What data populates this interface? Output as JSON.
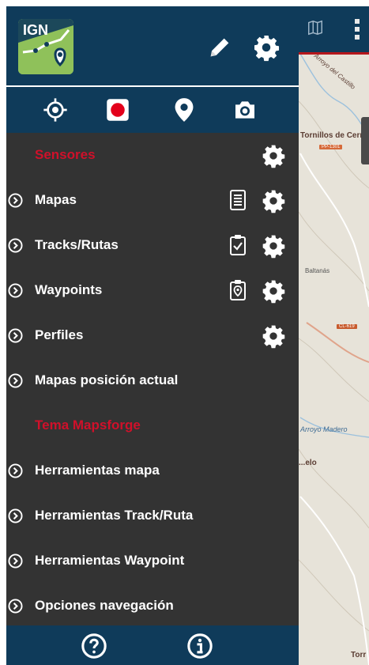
{
  "map": {
    "labels": [
      {
        "text": "Arroyo del Castillo"
      },
      {
        "text": "Tornillos de Cerrato"
      },
      {
        "text": "Baltanás"
      },
      {
        "text": "Arroyo Madero"
      },
      {
        "text": "...elo"
      },
      {
        "text": "Torr"
      }
    ],
    "roads": [
      {
        "text": "PP-1301"
      },
      {
        "text": "CL-619"
      }
    ]
  },
  "header": {
    "logo_text": "IGN",
    "icons": [
      "pencil-icon",
      "settings-icon"
    ]
  },
  "toolbar": {
    "items": [
      "crosshair-icon",
      "record-icon",
      "location-pin-icon",
      "camera-icon"
    ]
  },
  "menu": {
    "items": [
      {
        "label": "Sensores",
        "type": "category",
        "gear": true
      },
      {
        "label": "Mapas",
        "type": "item",
        "extra": "document-list-icon",
        "gear": true
      },
      {
        "label": "Tracks/Rutas",
        "type": "item",
        "extra": "clipboard-check-icon",
        "gear": true
      },
      {
        "label": "Waypoints",
        "type": "item",
        "extra": "clipboard-pin-icon",
        "gear": true
      },
      {
        "label": "Perfiles",
        "type": "item",
        "gear": true
      },
      {
        "label": "Mapas posición actual",
        "type": "item"
      },
      {
        "label": "Tema Mapsforge",
        "type": "category"
      },
      {
        "label": "Herramientas mapa",
        "type": "item"
      },
      {
        "label": "Herramientas Track/Ruta",
        "type": "item"
      },
      {
        "label": "Herramientas Waypoint",
        "type": "item"
      },
      {
        "label": "Opciones navegación",
        "type": "item"
      }
    ]
  },
  "footer": {
    "icons": [
      "help-icon",
      "info-icon"
    ]
  },
  "colors": {
    "header": "#0f3b5a",
    "drawer": "#333333",
    "category": "#d0102a",
    "record": "#e3001b",
    "logo": "#8fc15a"
  }
}
